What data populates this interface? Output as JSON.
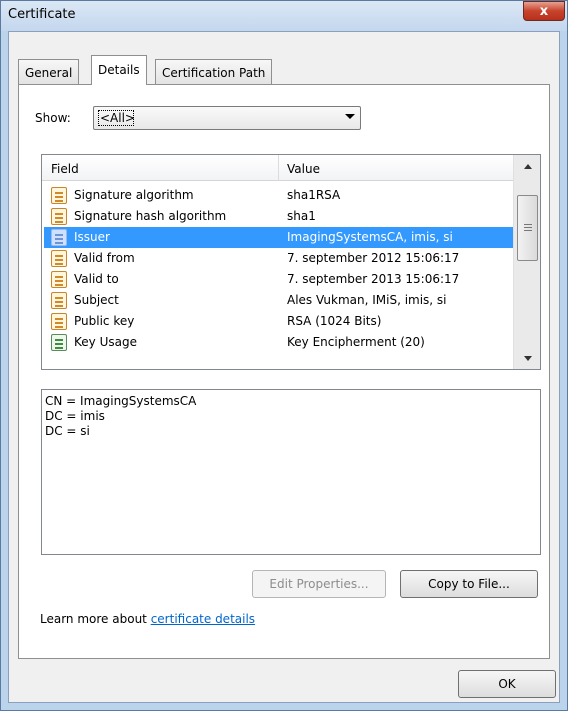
{
  "window": {
    "title": "Certificate",
    "close_glyph": "x"
  },
  "tabs": [
    {
      "label": "General",
      "active": false
    },
    {
      "label": "Details",
      "active": true
    },
    {
      "label": "Certification Path",
      "active": false
    }
  ],
  "show": {
    "label": "Show:",
    "selected": "<All>"
  },
  "list": {
    "columns": {
      "field": "Field",
      "value": "Value"
    },
    "rows": [
      {
        "field": "Signature algorithm",
        "value": "sha1RSA",
        "icon": "document-icon"
      },
      {
        "field": "Signature hash algorithm",
        "value": "sha1",
        "icon": "document-icon"
      },
      {
        "field": "Issuer",
        "value": "ImagingSystemsCA, imis, si",
        "icon": "document-icon",
        "selected": true
      },
      {
        "field": "Valid from",
        "value": "7. september 2012 15:06:17",
        "icon": "document-icon"
      },
      {
        "field": "Valid to",
        "value": "7. september 2013 15:06:17",
        "icon": "document-icon"
      },
      {
        "field": "Subject",
        "value": "Ales Vukman, IMiS, imis, si",
        "icon": "document-icon"
      },
      {
        "field": "Public key",
        "value": "RSA (1024 Bits)",
        "icon": "document-icon"
      },
      {
        "field": "Key Usage",
        "value": "Key Encipherment (20)",
        "icon": "key-usage-icon"
      }
    ]
  },
  "detail": {
    "lines": [
      "CN = ImagingSystemsCA",
      "DC = imis",
      "DC = si"
    ]
  },
  "buttons": {
    "edit_properties": "Edit Properties...",
    "copy_to_file": "Copy to File...",
    "ok": "OK"
  },
  "learn_more": {
    "prefix": "Learn more about ",
    "link": "certificate details"
  }
}
